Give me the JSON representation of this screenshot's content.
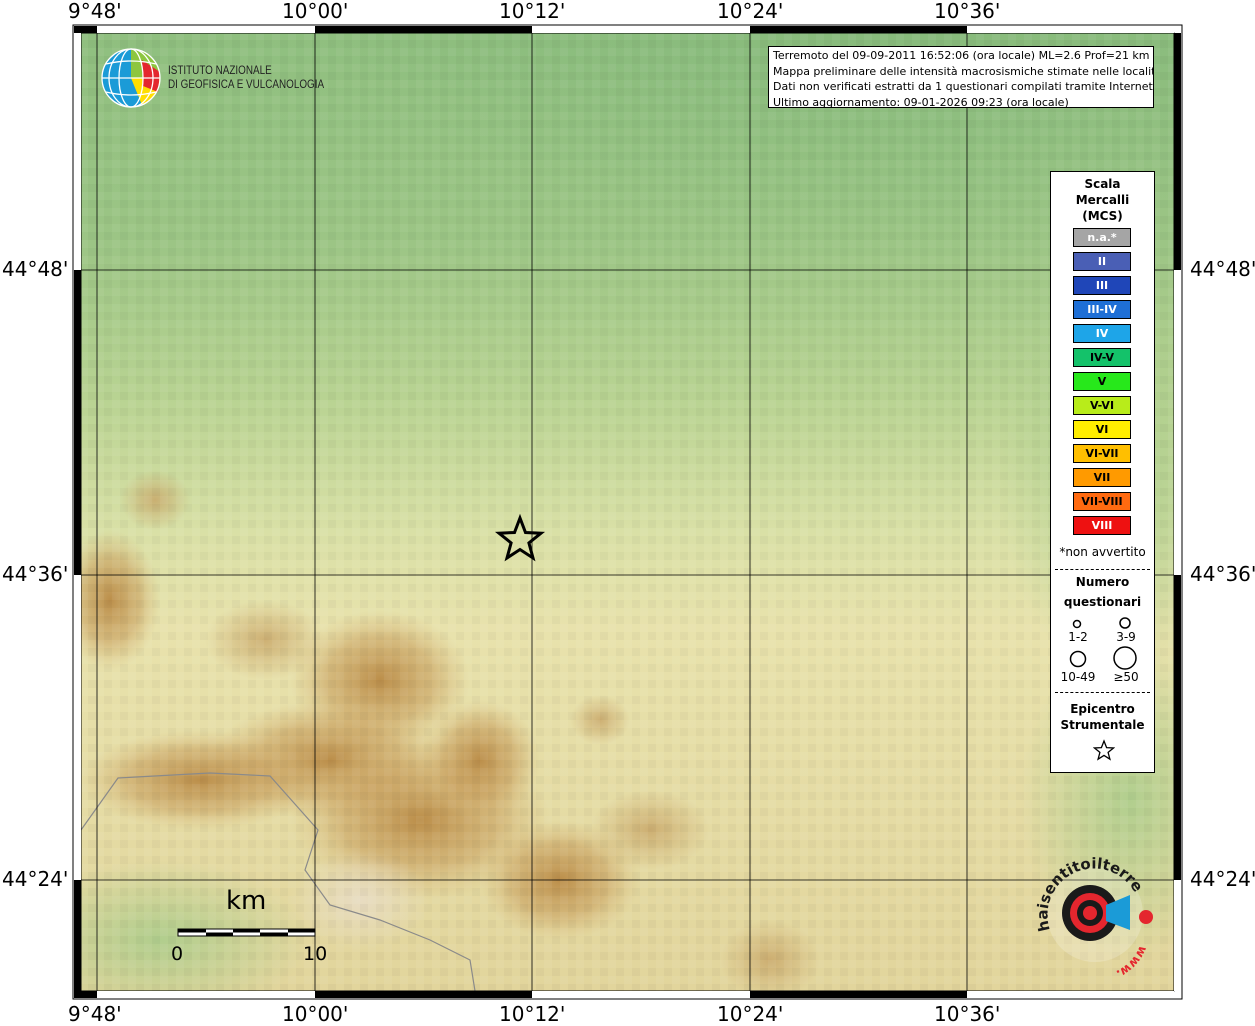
{
  "axes": {
    "lon_labels": [
      "9°48'",
      "10°00'",
      "10°12'",
      "10°24'",
      "10°36'"
    ],
    "lat_labels": [
      "44°48'",
      "44°36'",
      "44°24'"
    ]
  },
  "institute": {
    "line1": "ISTITUTO NAZIONALE",
    "line2": "DI GEOFISICA E VULCANOLOGIA",
    "logo_colors": [
      "#1b9bd7",
      "#8dc63f",
      "#ffde00",
      "#e4262e"
    ]
  },
  "info": {
    "line1": "Terremoto del 09-09-2011 16:52:06 (ora locale) ML=2.6 Prof=21 km",
    "line2": "Mappa preliminare delle intensità macrosismiche stimate nelle località",
    "line3": "Dati non verificati estratti da 1 questionari compilati tramite Internet.",
    "line4": "Ultimo aggiornamento: 09-01-2026 09:23 (ora locale)"
  },
  "legend": {
    "title1": "Scala",
    "title2": "Mercalli",
    "title3": "(MCS)",
    "classes": [
      {
        "label": "n.a.*",
        "color": "#a5a5a5"
      },
      {
        "label": "II",
        "color": "#4a5fb5"
      },
      {
        "label": "III",
        "color": "#1f46b8"
      },
      {
        "label": "III-IV",
        "color": "#1e6fd6"
      },
      {
        "label": "IV",
        "color": "#1ea5e8"
      },
      {
        "label": "IV-V",
        "color": "#14c26a"
      },
      {
        "label": "V",
        "color": "#27e81b"
      },
      {
        "label": "V-VI",
        "color": "#b8ec1a"
      },
      {
        "label": "VI",
        "color": "#ffee00"
      },
      {
        "label": "VI-VII",
        "color": "#ffbf00"
      },
      {
        "label": "VII",
        "color": "#ff9a00"
      },
      {
        "label": "VII-VIII",
        "color": "#ff6a10"
      },
      {
        "label": "VIII",
        "color": "#ee1111"
      }
    ],
    "note": "*non avvertito",
    "numero1": "Numero",
    "numero2": "questionari",
    "size_labels": [
      "1-2",
      "3-9",
      "10-49",
      "≥50"
    ],
    "epi1": "Epicentro",
    "epi2": "Strumentale"
  },
  "scalebar": {
    "unit": "km",
    "start": "0",
    "end": "10"
  },
  "hsti_logo": {
    "text_main": "haisentitoilterremoto.it",
    "text_www": "www.",
    "colors": [
      "#1a1a1a",
      "#e4262e",
      "#1b9bd7"
    ]
  },
  "epicenter": {
    "lon": "10°11'",
    "lat": "44°37'"
  }
}
